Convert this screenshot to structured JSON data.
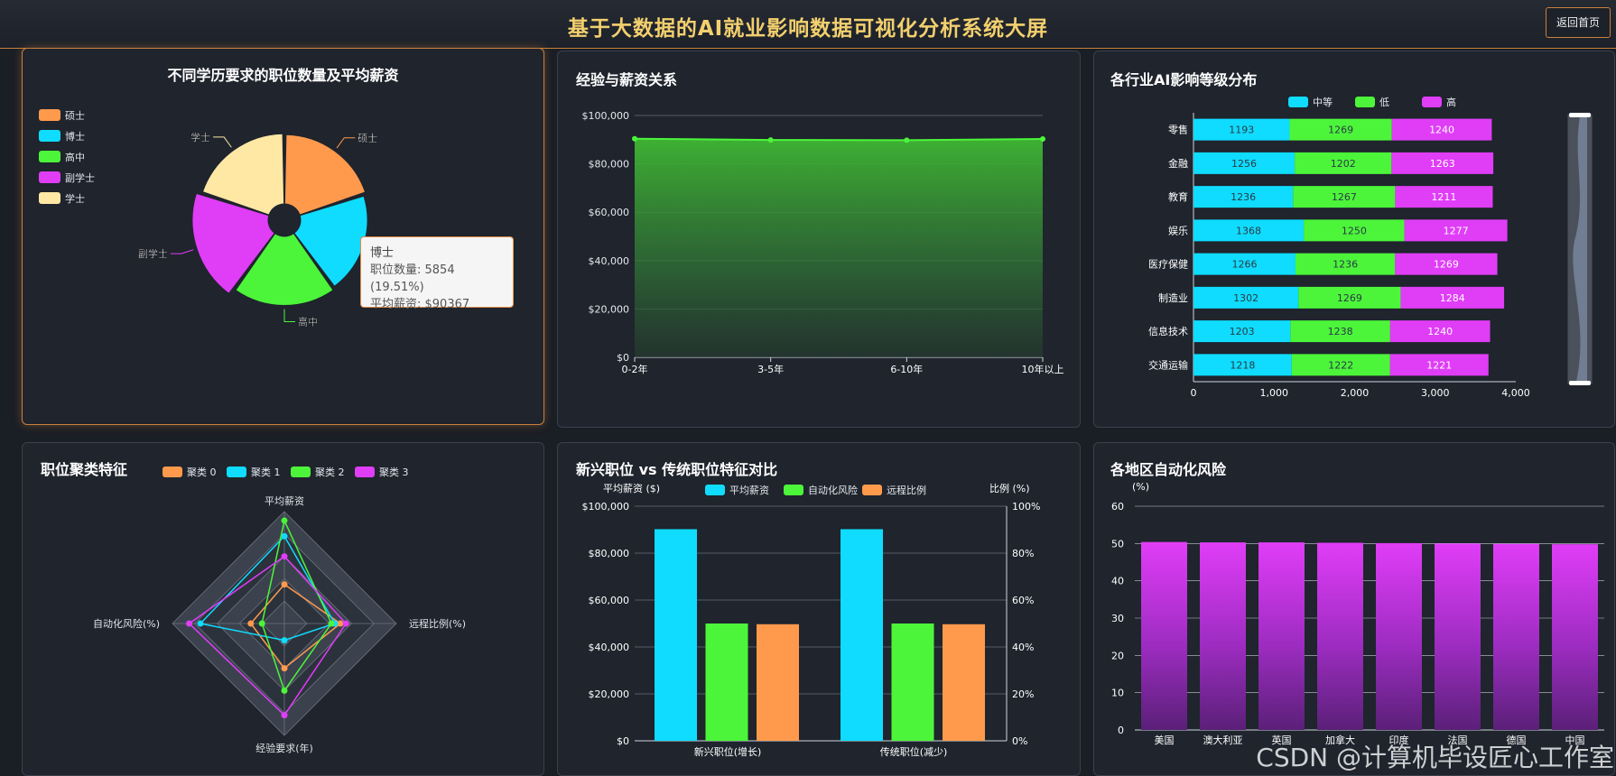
{
  "header": {
    "title": "基于大数据的AI就业影响数据可视化分析系统大屏",
    "back_label": "返回首页"
  },
  "colors": {
    "orange": "#ff9a4d",
    "cyan": "#0fdcff",
    "green": "#4cf53a",
    "magenta": "#e03df7",
    "beige": "#ffe8a3"
  },
  "panels": {
    "education": {
      "title": "不同学历要求的职位数量及平均薪资",
      "tooltip": {
        "name": "博士",
        "count_line": "职位数量: 5854 (19.51%)",
        "salary_line": "平均薪资: $90367"
      }
    },
    "experience": {
      "title": "经验与薪资关系"
    },
    "industry": {
      "title": "各行业AI影响等级分布"
    },
    "cluster": {
      "title": "职位聚类特征"
    },
    "emerging": {
      "title": "新兴职位 vs 传统职位特征对比"
    },
    "region": {
      "title": "各地区自动化风险"
    }
  },
  "watermark": "CSDN @计算机毕设匠心工作室",
  "chart_data": [
    {
      "id": "education",
      "type": "pie",
      "rose": true,
      "legend": [
        "硕士",
        "博士",
        "高中",
        "副学士",
        "学士"
      ],
      "categories": [
        "硕士",
        "博士",
        "高中",
        "副学士",
        "学士"
      ],
      "values": [
        5960,
        5854,
        5950,
        6236,
        6000
      ],
      "colors": [
        "#ff9a4d",
        "#0fdcff",
        "#4cf53a",
        "#e03df7",
        "#ffe8a3"
      ],
      "legend_position": "top-left"
    },
    {
      "id": "experience",
      "type": "area",
      "x": [
        "0-2年",
        "3-5年",
        "6-10年",
        "10年以上"
      ],
      "y": [
        90400,
        89900,
        89800,
        90300
      ],
      "yticks": [
        "$0",
        "$20,000",
        "$40,000",
        "$60,000",
        "$80,000",
        "$100,000"
      ],
      "ylim": [
        0,
        100000
      ]
    },
    {
      "id": "industry",
      "type": "bar",
      "orientation": "horizontal",
      "stacked": true,
      "categories": [
        "零售",
        "金融",
        "教育",
        "娱乐",
        "医疗保健",
        "制造业",
        "信息技术",
        "交通运输"
      ],
      "series": [
        {
          "name": "中等",
          "values": [
            1193,
            1256,
            1236,
            1368,
            1266,
            1302,
            1203,
            1218
          ]
        },
        {
          "name": "低",
          "values": [
            1269,
            1202,
            1267,
            1250,
            1236,
            1269,
            1238,
            1222
          ]
        },
        {
          "name": "高",
          "values": [
            1240,
            1263,
            1211,
            1277,
            1269,
            1284,
            1240,
            1221
          ]
        }
      ],
      "xticks": [
        "0",
        "1,000",
        "2,000",
        "3,000",
        "4,000"
      ],
      "xlim": [
        0,
        4000
      ]
    },
    {
      "id": "cluster",
      "type": "radar",
      "legend": [
        "聚类 0",
        "聚类 1",
        "聚类 2",
        "聚类 3"
      ],
      "indicators": [
        "平均薪资",
        "远程比例(%)",
        "经验要求(年)",
        "自动化风险(%)"
      ],
      "series": [
        {
          "name": "聚类 0",
          "values": [
            0.35,
            0.5,
            0.4,
            0.3
          ]
        },
        {
          "name": "聚类 1",
          "values": [
            0.78,
            0.45,
            0.15,
            0.75
          ]
        },
        {
          "name": "聚类 2",
          "values": [
            0.92,
            0.42,
            0.6,
            0.2
          ]
        },
        {
          "name": "聚类 3",
          "values": [
            0.6,
            0.55,
            0.82,
            0.85
          ]
        }
      ]
    },
    {
      "id": "emerging",
      "type": "bar",
      "categories": [
        "新兴职位(增长)",
        "传统职位(减少)"
      ],
      "series": [
        {
          "name": "平均薪资",
          "axis": "left",
          "values": [
            90200,
            90200
          ]
        },
        {
          "name": "自动化风险",
          "axis": "right",
          "values": [
            50,
            50
          ]
        },
        {
          "name": "远程比例",
          "axis": "right",
          "values": [
            49.7,
            49.7
          ]
        }
      ],
      "ylabel": "平均薪资 ($)",
      "ylabel_right": "比例 (%)",
      "yticks": [
        "$0",
        "$20,000",
        "$40,000",
        "$60,000",
        "$80,000",
        "$100,000"
      ],
      "yticks_right": [
        "0%",
        "20%",
        "40%",
        "60%",
        "80%",
        "100%"
      ],
      "ylim": [
        0,
        100000
      ],
      "ylim_right": [
        0,
        100
      ]
    },
    {
      "id": "region",
      "type": "bar",
      "categories": [
        "美国",
        "澳大利亚",
        "英国",
        "加拿大",
        "印度",
        "法国",
        "德国",
        "中国"
      ],
      "values": [
        50.4,
        50.3,
        50.3,
        50.2,
        50.1,
        50.0,
        49.9,
        49.8
      ],
      "ylabel": "(%)",
      "yticks": [
        "0",
        "10",
        "20",
        "30",
        "40",
        "50",
        "60"
      ],
      "ylim": [
        0,
        60
      ]
    }
  ]
}
